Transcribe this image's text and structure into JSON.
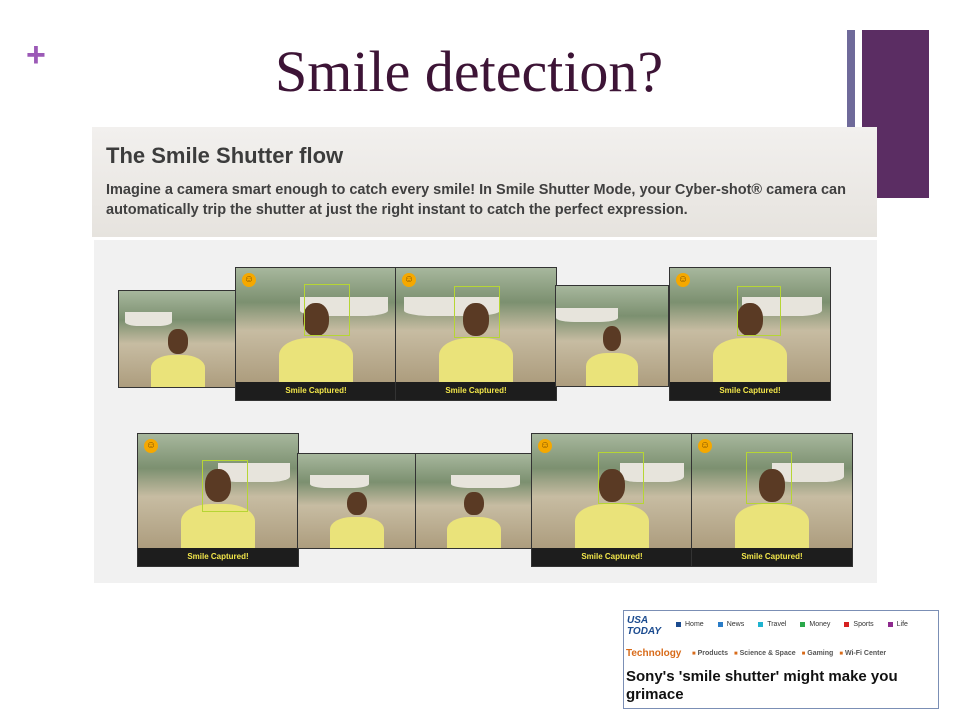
{
  "slide": {
    "bullet": "+",
    "title": "Smile detection?"
  },
  "banner": {
    "title": "The Smile Shutter flow",
    "description": "Imagine a camera smart enough to catch every smile! In Smile Shutter Mode, your Cyber-shot® camera can automatically trip the shutter at just the right instant to catch the perfect expression."
  },
  "flow": {
    "caption": "Smile Captured!",
    "smiley_icon": "smiley-face-icon"
  },
  "news": {
    "logo": "USA TODAY",
    "nav": [
      {
        "label": "Home",
        "color": "#1b4b8f"
      },
      {
        "label": "News",
        "color": "#2a7cc7"
      },
      {
        "label": "Travel",
        "color": "#1fb3d0"
      },
      {
        "label": "Money",
        "color": "#2aa84a"
      },
      {
        "label": "Sports",
        "color": "#d62020"
      },
      {
        "label": "Life",
        "color": "#8e2a8e"
      }
    ],
    "section": "Technology",
    "subnav": [
      "Products",
      "Science & Space",
      "Gaming",
      "Wi-Fi Center"
    ],
    "headline": "Sony's 'smile shutter' might make you grimace"
  },
  "colors": {
    "title": "#3d1436",
    "accent_purple": "#5b2d63",
    "accent_thin": "#6f6a9a",
    "face_box": "#b6d534",
    "caption_text": "#f2e64a"
  }
}
